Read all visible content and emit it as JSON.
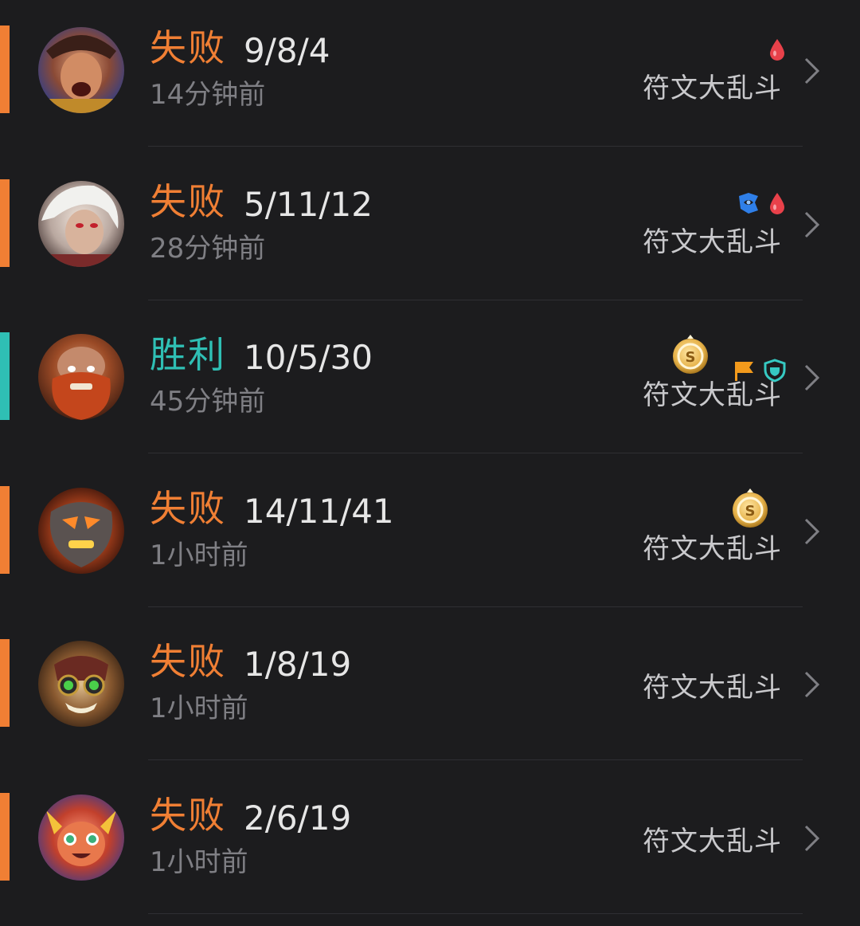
{
  "colors": {
    "loss": "#f07f34",
    "win": "#2fbfb4",
    "background": "#1c1c1e"
  },
  "matches": [
    {
      "result": "失败",
      "outcome": "loss",
      "kda": "9/8/4",
      "time": "14分钟前",
      "mode": "符文大乱斗",
      "badges": [
        "first-blood-icon"
      ]
    },
    {
      "result": "失败",
      "outcome": "loss",
      "kda": "5/11/12",
      "time": "28分钟前",
      "mode": "符文大乱斗",
      "badges": [
        "support-shield-icon",
        "first-blood-icon"
      ]
    },
    {
      "result": "胜利",
      "outcome": "win",
      "kda": "10/5/30",
      "time": "45分钟前",
      "mode": "符文大乱斗",
      "badges": [
        "gold-coin-icon",
        "flag-icon",
        "tower-shield-icon"
      ]
    },
    {
      "result": "失败",
      "outcome": "loss",
      "kda": "14/11/41",
      "time": "1小时前",
      "mode": "符文大乱斗",
      "badges": [
        "gold-coin-icon"
      ]
    },
    {
      "result": "失败",
      "outcome": "loss",
      "kda": "1/8/19",
      "time": "1小时前",
      "mode": "符文大乱斗",
      "badges": []
    },
    {
      "result": "失败",
      "outcome": "loss",
      "kda": "2/6/19",
      "time": "1小时前",
      "mode": "符文大乱斗",
      "badges": []
    }
  ]
}
